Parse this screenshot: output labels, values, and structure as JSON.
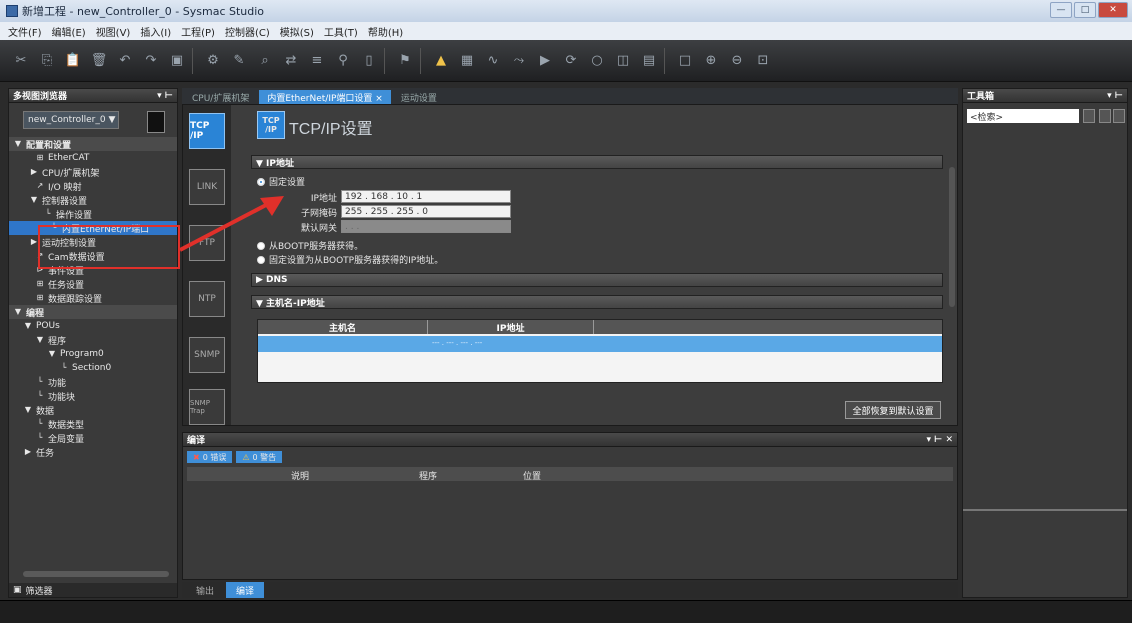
{
  "window": {
    "title": "新增工程 - new_Controller_0 - Sysmac Studio",
    "buttons": [
      "—",
      "□",
      "✕"
    ]
  },
  "menu": [
    "文件(F)",
    "编辑(E)",
    "视图(V)",
    "插入(I)",
    "工程(P)",
    "控制器(C)",
    "模拟(S)",
    "工具(T)",
    "帮助(H)"
  ],
  "toolbar": [
    "cut-icon",
    "copy-icon",
    "paste-icon",
    "delete-icon",
    "undo-icon",
    "redo-icon",
    "save-icon",
    "|",
    "build-icon",
    "tools-icon",
    "find-icon",
    "replace-icon",
    "list-icon",
    "binoculars-icon",
    "doc-icon",
    "|",
    "bookmark-icon",
    "|",
    "warning-icon",
    "chart-icon",
    "wave-icon",
    "step-icon",
    "run-icon",
    "sync-icon",
    "circle-icon",
    "monitor-icon",
    "grid-icon",
    "|",
    "box-icon",
    "zoom-in-icon",
    "zoom-out-icon",
    "zoom-fit-icon"
  ],
  "left": {
    "header": "多视图浏览器",
    "controller": "new_Controller_0",
    "items": [
      {
        "label": "配置和设置",
        "ind": 4,
        "icon": "▼",
        "bold": true,
        "grp": true
      },
      {
        "label": "EtherCAT",
        "ind": 26,
        "icon": "⊞"
      },
      {
        "label": "CPU/扩展机架",
        "ind": 20,
        "icon": "▶"
      },
      {
        "label": "I/O 映射",
        "ind": 26,
        "icon": "↗"
      },
      {
        "label": "控制器设置",
        "ind": 20,
        "icon": "▼"
      },
      {
        "label": "操作设置",
        "ind": 34,
        "icon": "└"
      },
      {
        "label": "内置EtherNet/IP端口",
        "ind": 40,
        "icon": "└",
        "sel": true
      },
      {
        "label": "运动控制设置",
        "ind": 20,
        "icon": "▶"
      },
      {
        "label": "Cam数据设置",
        "ind": 26,
        "icon": "↗"
      },
      {
        "label": "事件设置",
        "ind": 26,
        "icon": "⊳"
      },
      {
        "label": "任务设置",
        "ind": 26,
        "icon": "⊞"
      },
      {
        "label": "数据跟踪设置",
        "ind": 26,
        "icon": "⊞"
      },
      {
        "label": "编程",
        "ind": 4,
        "icon": "▼",
        "bold": true,
        "grp": true
      },
      {
        "label": "POUs",
        "ind": 14,
        "icon": "▼"
      },
      {
        "label": "程序",
        "ind": 26,
        "icon": "▼"
      },
      {
        "label": "Program0",
        "ind": 38,
        "icon": "▼"
      },
      {
        "label": "Section0",
        "ind": 50,
        "icon": "└"
      },
      {
        "label": "功能",
        "ind": 26,
        "icon": "└"
      },
      {
        "label": "功能块",
        "ind": 26,
        "icon": "└"
      },
      {
        "label": "数据",
        "ind": 14,
        "icon": "▼"
      },
      {
        "label": "数据类型",
        "ind": 26,
        "icon": "└"
      },
      {
        "label": "全局变量",
        "ind": 26,
        "icon": "└"
      },
      {
        "label": "任务",
        "ind": 14,
        "icon": "▶"
      }
    ],
    "footer": "筛选器"
  },
  "tabs": [
    "CPU/扩展机架",
    "内置EtherNet/IP端口设置 ×",
    "运动设置"
  ],
  "editor": {
    "side_tabs": [
      "TCP /IP",
      "LINK",
      "FTP",
      "NTP",
      "SNMP",
      "SNMP Trap"
    ],
    "page_icon": "TCP /IP",
    "title": "TCP/IP设置",
    "sec_ip": "▼ IP地址",
    "radio_fixed": "固定设置",
    "ip_label": "IP地址",
    "ip_value": "192 . 168 . 10 . 1",
    "mask_label": "子网掩码",
    "mask_value": "255 . 255 . 255 . 0",
    "gw_label": "默认网关",
    "gw_value": "   .   .   .",
    "radio_bootp": "从BOOTP服务器获得。",
    "radio_bootp_fixed": "固定设置为从BOOTP服务器获得的IP地址。",
    "sec_dns": "▶ DNS",
    "sec_hosts": "▼ 主机名-IP地址",
    "col_host": "主机名",
    "col_ip": "IP地址",
    "row_ip": "--- . --- . --- . ---",
    "apply": "全部恢复到默认设置"
  },
  "bottom": {
    "header": "编译",
    "filter_err": "0 错误",
    "filter_warn": "0 警告",
    "cols": [
      "说明",
      "程序",
      "位置"
    ],
    "tabs": [
      "输出",
      "编译"
    ]
  },
  "right": {
    "header": "工具箱",
    "search": "<检索>"
  }
}
